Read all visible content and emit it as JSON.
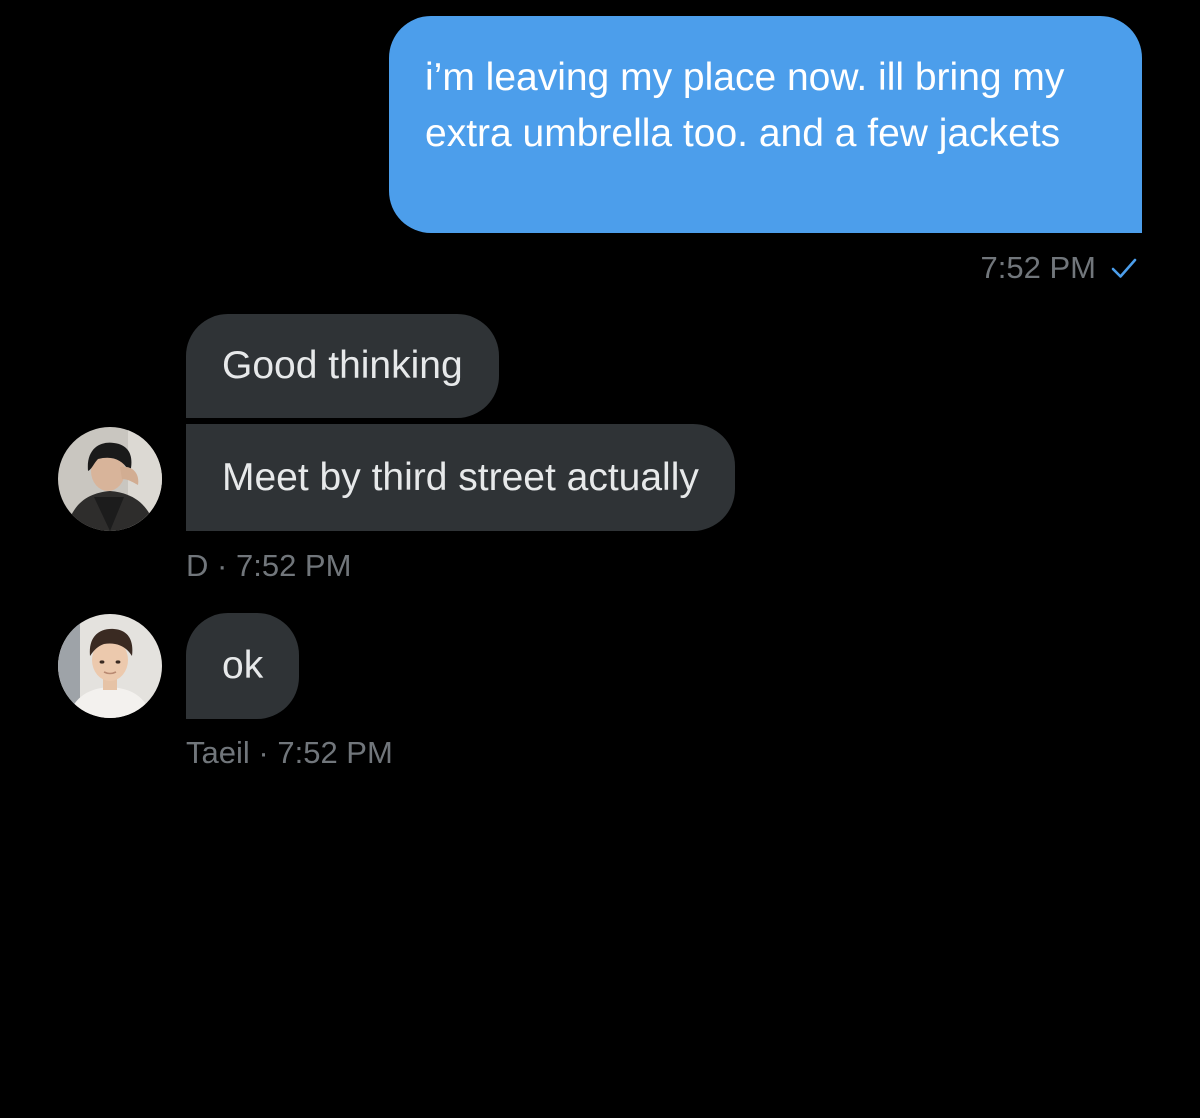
{
  "messages": {
    "outgoing": {
      "text": "i’m leaving my place now. ill bring my extra umbrella too. and a few jackets",
      "time": "7:52 PM",
      "status_icon": "checkmark-icon"
    },
    "group_d": {
      "bubble_1": "Good thinking",
      "bubble_2": "Meet by third street actually",
      "sender": "D",
      "separator": "·",
      "time": "7:52 PM"
    },
    "group_taeil": {
      "bubble_1": "ok",
      "sender": "Taeil",
      "separator": "·",
      "time": "7:52 PM"
    }
  },
  "colors": {
    "background": "#000000",
    "outgoing_bubble": "#4c9eeb",
    "incoming_bubble": "#2f3336",
    "meta_text": "#71767b",
    "read_check": "#4c9eeb"
  }
}
